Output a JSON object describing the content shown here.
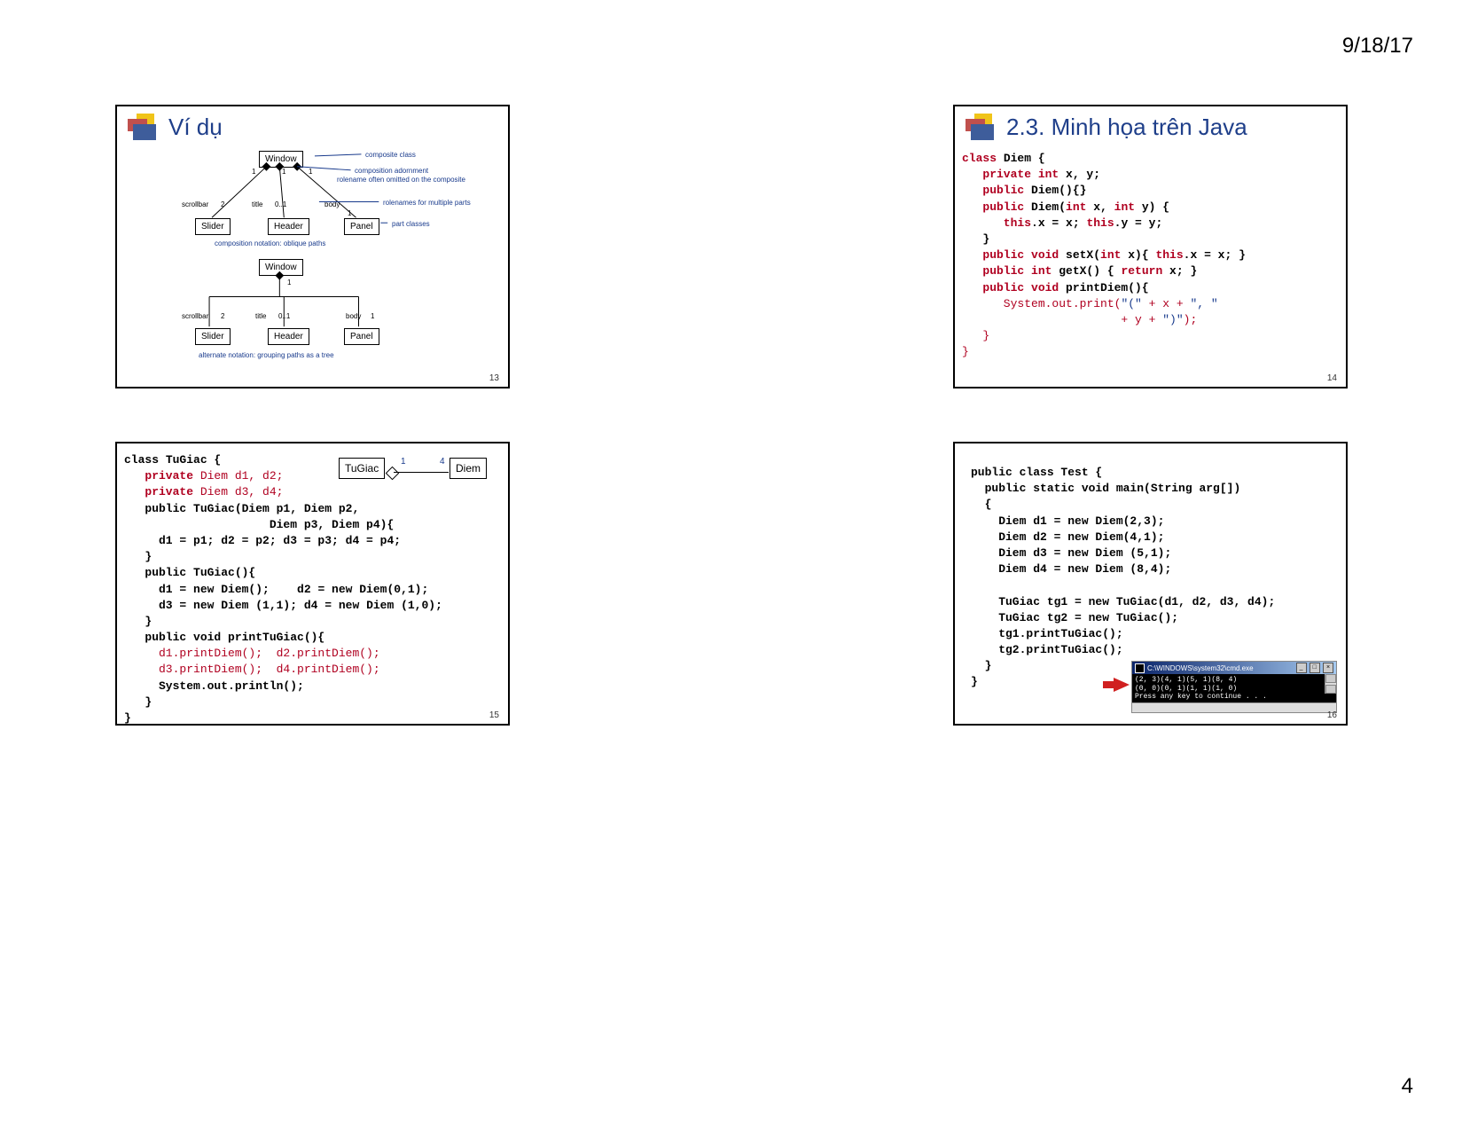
{
  "page": {
    "date": "9/18/17",
    "number": "4"
  },
  "slide1": {
    "number": "13",
    "title": "Ví dụ",
    "labels": {
      "window": "Window",
      "slider": "Slider",
      "header": "Header",
      "panel": "Panel",
      "scrollbar": "scrollbar",
      "title_role": "title",
      "body_role": "body",
      "m2": "2",
      "m1": "1",
      "m01": "0..1",
      "composite_class": "composite class",
      "comp_adorn": "composition adornment",
      "rolenames_omitted": "rolename often omitted on the composite",
      "rolenames_multi": "rolenames for multiple parts",
      "part_classes": "part classes",
      "caption1": "composition notation: oblique paths",
      "caption2": "alternate notation: grouping paths as a tree"
    }
  },
  "slide2": {
    "number": "14",
    "title": "2.3. Minh họa trên Java",
    "code": {
      "l1a": "class",
      "l1b": " Diem {",
      "l2a": "   private int",
      "l2b": " x, y;",
      "l3a": "   public",
      "l3b": " Diem(){}",
      "l4a": "   public",
      "l4b": " Diem(",
      "l4c": "int",
      "l4d": " x, ",
      "l4e": "int",
      "l4f": " y) {",
      "l5a": "      this",
      "l5b": ".x = x; ",
      "l5c": "this",
      "l5d": ".y = y;",
      "l6": "   }",
      "l7a": "   public void",
      "l7b": " setX(",
      "l7c": "int",
      "l7d": " x){ ",
      "l7e": "this",
      "l7f": ".x = x; }",
      "l8a": "   public int",
      "l8b": " getX() { ",
      "l8c": "return",
      "l8d": " x; }",
      "l9a": "   public void",
      "l9b": " printDiem(){",
      "l10a": "      System.out.print(",
      "l10b": "\"(\"",
      "l10c": " + x + ",
      "l10d": "\", \"",
      "l11a": "                       + y + ",
      "l11b": "\")\"",
      "l11c": ");",
      "l12": "   }",
      "l13": "}"
    }
  },
  "slide3": {
    "number": "15",
    "uml": {
      "tugiac": "TuGiac",
      "diem": "Diem",
      "m1": "1",
      "m4": "4"
    },
    "code": {
      "l1a": "class",
      "l1b": " TuGiac {",
      "l2a": "   private",
      "l2b": " Diem d1, d2;",
      "l3a": "   private",
      "l3b": " Diem d3, d4;",
      "l4a": "   public",
      "l4b": " TuGiac(Diem p1, Diem p2,",
      "l5": "                     Diem p3, Diem p4){",
      "l6": "     d1 = p1; d2 = p2; d3 = p3; d4 = p4;",
      "l7": "   }",
      "l8a": "   public",
      "l8b": " TuGiac(){",
      "l9a": "     d1 = ",
      "l9b": "new",
      "l9c": " Diem();    d2 = ",
      "l9d": "new",
      "l9e": " Diem(0,1);",
      "l10a": "     d3 = ",
      "l10b": "new",
      "l10c": " Diem (1,1); d4 = ",
      "l10d": "new",
      "l10e": " Diem (1,0);",
      "l11": "   }",
      "l12a": "   public void",
      "l12b": " printTuGiac(){",
      "l13": "     d1.printDiem();  d2.printDiem();",
      "l14": "     d3.printDiem();  d4.printDiem();",
      "l15": "     System.out.println();",
      "l16": "   }",
      "l17": "}"
    }
  },
  "slide4": {
    "number": "16",
    "code": {
      "l1a": "public class",
      "l1b": " Test {",
      "l2a": "  public static void",
      "l2b": " main(String arg[])",
      "l3": "  {",
      "l4a": "    Diem d1 = ",
      "l4b": "new",
      "l4c": " Diem(2,3);",
      "l5a": "    Diem d2 = ",
      "l5b": "new",
      "l5c": " Diem(4,1);",
      "l6a": "    Diem d3 = ",
      "l6b": "new",
      "l6c": " Diem (5,1);",
      "l7a": "    Diem d4 = ",
      "l7b": "new",
      "l7c": " Diem (8,4);",
      "blank": "",
      "l8a": "    TuGiac tg1 = ",
      "l8b": "new",
      "l8c": " TuGiac(d1, d2, d3, d4);",
      "l9a": "    TuGiac tg2 = ",
      "l9b": "new",
      "l9c": " TuGiac();",
      "l10": "    tg1.printTuGiac();",
      "l11": "    tg2.printTuGiac();",
      "l12": "  }",
      "l13": "}"
    },
    "console": {
      "title": "C:\\WINDOWS\\system32\\cmd.exe",
      "line1": "(2, 3)(4, 1)(5, 1)(8, 4)",
      "line2": "(0, 0)(0, 1)(1, 1)(1, 0)",
      "line3": "Press any key to continue . . ."
    }
  }
}
